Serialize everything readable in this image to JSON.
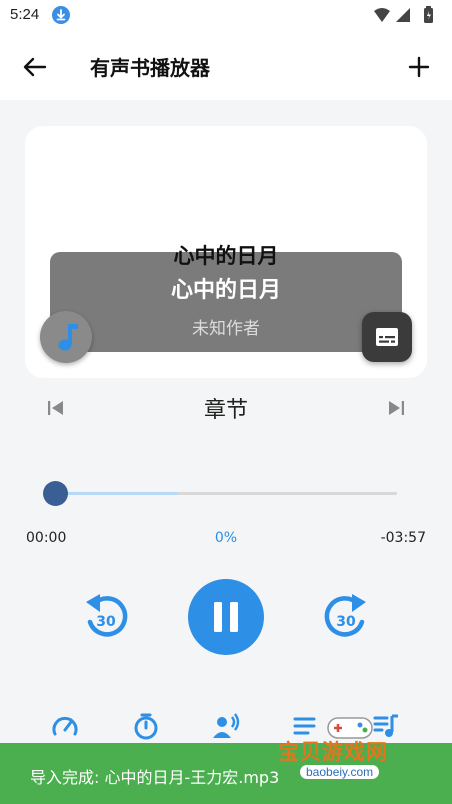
{
  "status_bar": {
    "time": "5:24"
  },
  "app_bar": {
    "title": "有声书播放器"
  },
  "book": {
    "title_top": "心中的日月",
    "title": "心中的日月",
    "author": "未知作者"
  },
  "chapter": {
    "label": "章节"
  },
  "progress": {
    "elapsed": "00:00",
    "percent_label": "0%",
    "remaining": "-03:57",
    "played_fraction": 0.0,
    "buffered_fraction": 0.36
  },
  "controls": {
    "rewind_seconds": "30",
    "forward_seconds": "30"
  },
  "snackbar": {
    "message": "导入完成: 心中的日月-王力宏.mp3"
  },
  "watermark": {
    "text": "宝贝游戏网",
    "url": "baobeiy.com"
  },
  "colors": {
    "accent": "#2d8fe6",
    "thumb": "#3a5f95",
    "snackbar": "#4bae4f"
  }
}
